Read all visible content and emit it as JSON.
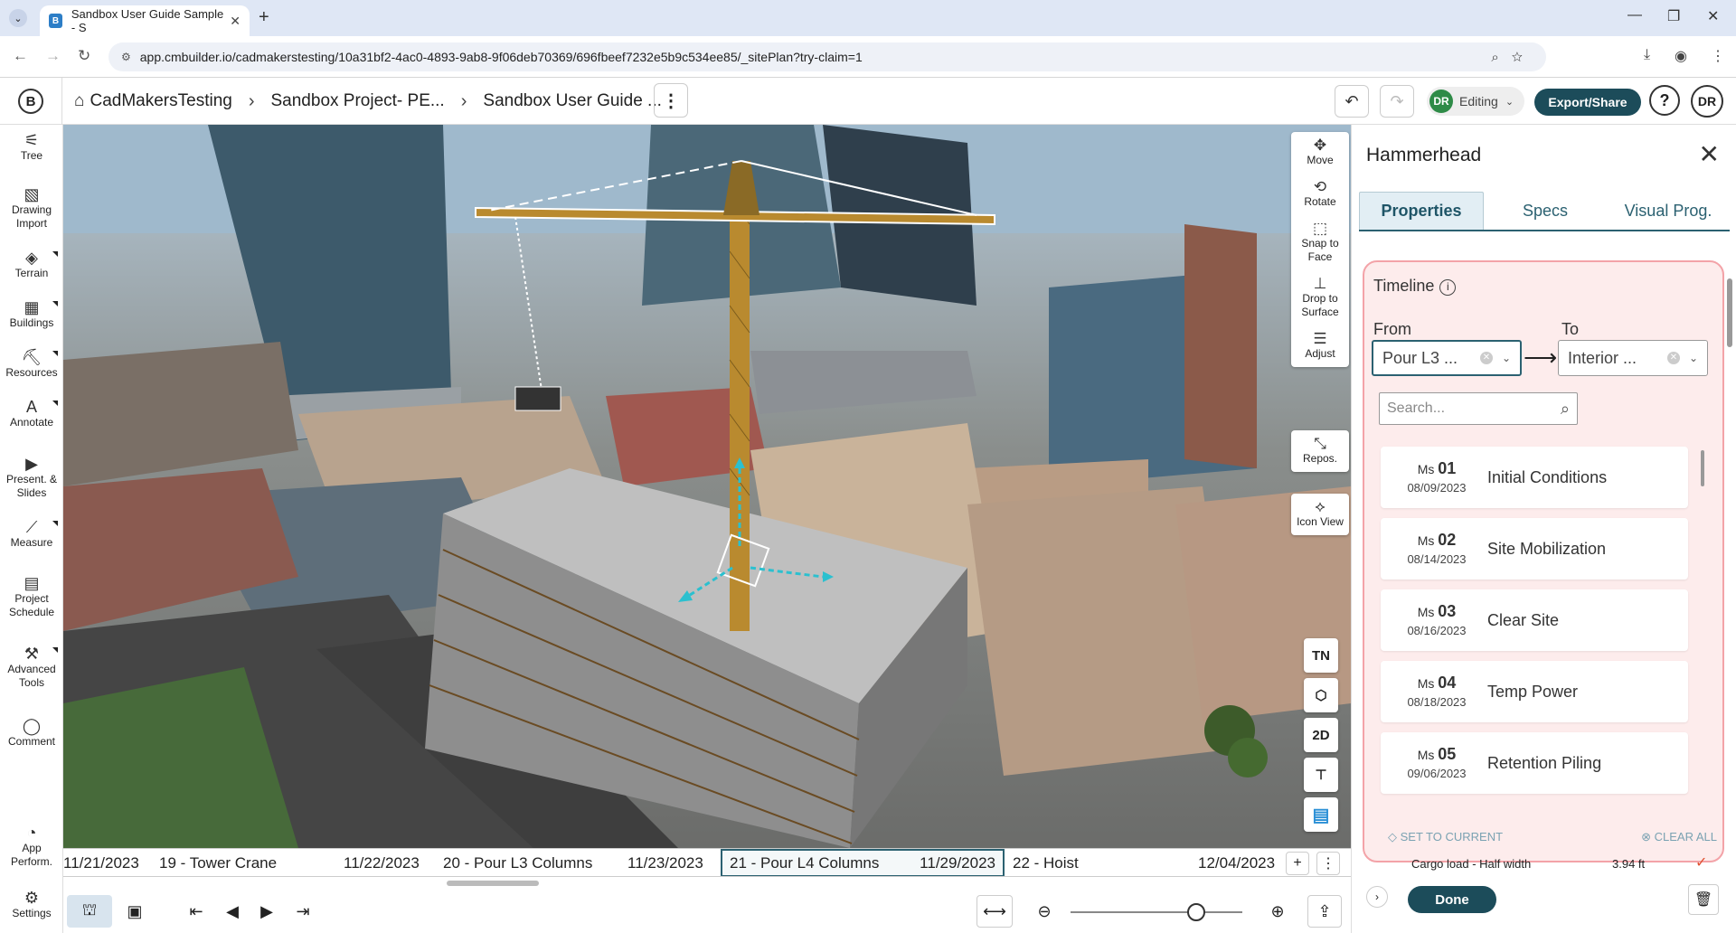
{
  "browser": {
    "tab_title": "Sandbox User Guide Sample - S",
    "url": "app.cmbuilder.io/cadmakerstesting/10a31bf2-4ac0-4893-9ab8-9f06deb70369/696fbeef7232e5b9c534ee85/_sitePlan?try-claim=1"
  },
  "header": {
    "logo": "B",
    "breadcrumbs": [
      "CadMakersTesting",
      "Sandbox Project- PE...",
      "Sandbox User Guide ..."
    ],
    "editing_initials": "DR",
    "editing_label": "Editing",
    "export_label": "Export/Share",
    "help_label": "?",
    "avatar": "DR"
  },
  "left_tools": [
    {
      "label": "Tree",
      "icon": "tree-icon"
    },
    {
      "label": "Drawing Import",
      "icon": "image-icon"
    },
    {
      "label": "Terrain",
      "icon": "terrain-icon"
    },
    {
      "label": "Buildings",
      "icon": "buildings-icon"
    },
    {
      "label": "Resources",
      "icon": "resources-icon"
    },
    {
      "label": "Annotate",
      "icon": "annotate-icon"
    },
    {
      "label": "Present. & Slides",
      "icon": "presentation-icon"
    },
    {
      "label": "Measure",
      "icon": "measure-icon"
    },
    {
      "label": "Project Schedule",
      "icon": "calendar-icon"
    },
    {
      "label": "Advanced Tools",
      "icon": "tools-icon"
    },
    {
      "label": "Comment",
      "icon": "comment-icon"
    },
    {
      "label": "App Perform.",
      "icon": "performance-icon"
    },
    {
      "label": "Settings",
      "icon": "gear-icon"
    }
  ],
  "right_tools": [
    {
      "label": "Move",
      "icon": "move-icon"
    },
    {
      "label": "Rotate",
      "icon": "rotate-icon"
    },
    {
      "label": "Snap to Face",
      "icon": "snap-icon"
    },
    {
      "label": "Drop to Surface",
      "icon": "drop-icon"
    },
    {
      "label": "Adjust",
      "icon": "adjust-icon"
    },
    {
      "label": "Repos.",
      "icon": "reposition-icon"
    },
    {
      "label": "Icon View",
      "icon": "icon-view-icon"
    }
  ],
  "view_buttons": {
    "north": "TN",
    "two_d": "2D"
  },
  "timeline_strip": [
    {
      "text": "11/21/2023"
    },
    {
      "text": "19 - Tower Crane"
    },
    {
      "text": "11/22/2023"
    },
    {
      "text": "20 - Pour L3 Columns"
    },
    {
      "text": "11/23/2023"
    },
    {
      "text": "21 - Pour L4 Columns"
    },
    {
      "text": "11/29/2023"
    },
    {
      "text": "22 - Hoist"
    },
    {
      "text": "12/04/2023"
    }
  ],
  "zoom_slider": {
    "value": 0.73
  },
  "panel": {
    "title": "Hammerhead",
    "tabs": [
      "Properties",
      "Specs",
      "Visual Prog."
    ],
    "active_tab": 0,
    "timeline": {
      "label": "Timeline",
      "from_label": "From",
      "to_label": "To",
      "from_value": "Pour L3 ...",
      "to_value": "Interior ...",
      "search_placeholder": "Search...",
      "milestones": [
        {
          "prefix": "Ms",
          "num": "01",
          "date": "08/09/2023",
          "name": "Initial Conditions"
        },
        {
          "prefix": "Ms",
          "num": "02",
          "date": "08/14/2023",
          "name": "Site Mobilization"
        },
        {
          "prefix": "Ms",
          "num": "03",
          "date": "08/16/2023",
          "name": "Clear Site"
        },
        {
          "prefix": "Ms",
          "num": "04",
          "date": "08/18/2023",
          "name": "Temp Power"
        },
        {
          "prefix": "Ms",
          "num": "05",
          "date": "09/06/2023",
          "name": "Retention Piling"
        }
      ],
      "set_to_current": "SET TO CURRENT",
      "clear_all": "CLEAR ALL"
    },
    "cargo_label": "Cargo load - Half width",
    "cargo_value": "3.94 ft",
    "done_label": "Done"
  }
}
